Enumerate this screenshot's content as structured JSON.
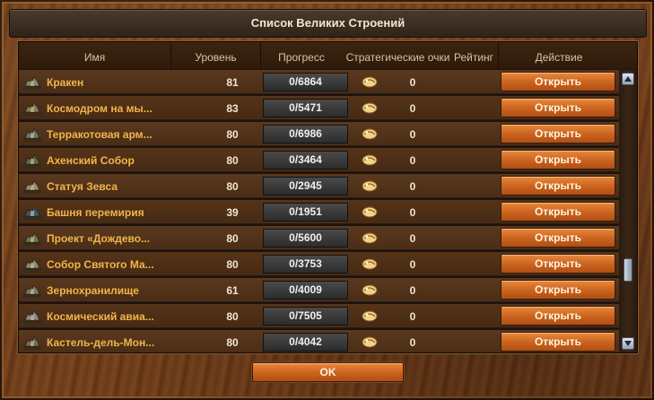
{
  "window": {
    "title": "Список Великих Строений"
  },
  "table": {
    "columns": [
      "Имя",
      "Уровень",
      "Прогресс",
      "Стратегические очки",
      "Рейтинг",
      "Действие"
    ],
    "rows": [
      {
        "name": "Кракен",
        "level": "81",
        "progress": "0/6864",
        "points": "0",
        "action": "Открыть",
        "icon": "kraken-icon"
      },
      {
        "name": "Космодром на мы...",
        "level": "83",
        "progress": "0/5471",
        "points": "0",
        "action": "Открыть",
        "icon": "cosmodrome-icon"
      },
      {
        "name": "Терракотовая арм...",
        "level": "80",
        "progress": "0/6986",
        "points": "0",
        "action": "Открыть",
        "icon": "terracotta-army-icon"
      },
      {
        "name": "Ахенский Собор",
        "level": "80",
        "progress": "0/3464",
        "points": "0",
        "action": "Открыть",
        "icon": "aachen-cathedral-icon"
      },
      {
        "name": "Статуя Зевса",
        "level": "80",
        "progress": "0/2945",
        "points": "0",
        "action": "Открыть",
        "icon": "zeus-statue-icon"
      },
      {
        "name": "Башня перемирия",
        "level": "39",
        "progress": "0/1951",
        "points": "0",
        "action": "Открыть",
        "icon": "truce-tower-icon"
      },
      {
        "name": "Проект «Дождево...",
        "level": "80",
        "progress": "0/5600",
        "points": "0",
        "action": "Открыть",
        "icon": "rain-forest-project-icon"
      },
      {
        "name": "Собор Святого Ма...",
        "level": "80",
        "progress": "0/3753",
        "points": "0",
        "action": "Открыть",
        "icon": "st-mark-cathedral-icon"
      },
      {
        "name": "Зернохранилище",
        "level": "61",
        "progress": "0/4009",
        "points": "0",
        "action": "Открыть",
        "icon": "granary-icon"
      },
      {
        "name": "Космический авиа...",
        "level": "80",
        "progress": "0/7505",
        "points": "0",
        "action": "Открыть",
        "icon": "space-carrier-icon"
      },
      {
        "name": "Кастель-дель-Мон...",
        "level": "80",
        "progress": "0/4042",
        "points": "0",
        "action": "Открыть",
        "icon": "castel-del-monte-icon"
      }
    ]
  },
  "footer": {
    "ok_label": "OK"
  },
  "colors": {
    "name": "#f0b54a",
    "button": "#c9621e",
    "progress_bg": "#3a3a3a"
  },
  "icons": {
    "forge_points": "forge-points-icon",
    "scroll_up": "scroll-up-arrow-icon",
    "scroll_down": "scroll-down-arrow-icon"
  }
}
